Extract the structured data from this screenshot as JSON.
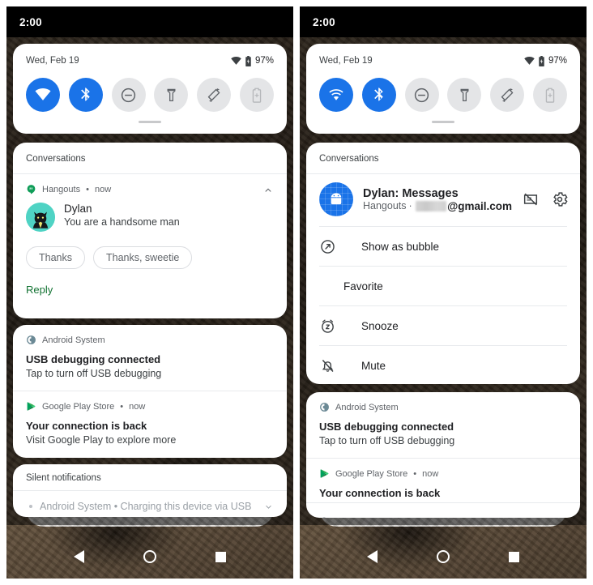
{
  "status_bar": {
    "clock": "2:00"
  },
  "quick_settings": {
    "date": "Wed, Feb 19",
    "battery_percent": "97%",
    "wifi_icon": "wifi-icon",
    "battery_icon": "battery-icon",
    "tiles": [
      {
        "name": "wifi-tile",
        "icon": "wifi-icon",
        "state": "on"
      },
      {
        "name": "bluetooth-tile",
        "icon": "bluetooth-icon",
        "state": "on"
      },
      {
        "name": "dnd-tile",
        "icon": "do-not-disturb-icon",
        "state": "off"
      },
      {
        "name": "flashlight-tile",
        "icon": "flashlight-icon",
        "state": "off"
      },
      {
        "name": "auto-rotate-tile",
        "icon": "auto-rotate-icon",
        "state": "off"
      },
      {
        "name": "battery-saver-tile",
        "icon": "battery-saver-icon",
        "state": "disabled"
      }
    ]
  },
  "left_panel": {
    "conversations_header": "Conversations",
    "conversation": {
      "app_name": "Hangouts",
      "separator": "•",
      "time": "now",
      "sender": "Dylan",
      "message": "You are a handsome man",
      "avatar": "cat-avatar",
      "collapse_icon": "chevron-up-icon",
      "smart_replies": [
        "Thanks",
        "Thanks, sweetie"
      ],
      "reply_label": "Reply",
      "reply_color": "#137333"
    },
    "notifications": [
      {
        "app_name": "Android System",
        "app_icon": "android-system-icon",
        "title": "USB debugging connected",
        "body": "Tap to turn off USB debugging"
      },
      {
        "app_name": "Google Play Store",
        "app_icon": "google-play-icon",
        "separator": "•",
        "time": "now",
        "title": "Your connection is back",
        "body": "Visit Google Play to explore more"
      }
    ],
    "silent": {
      "header": "Silent notifications",
      "row_text": "Android System • Charging this device via USB",
      "expand_icon": "chevron-down-icon"
    }
  },
  "right_panel": {
    "conversations_header": "Conversations",
    "conversation_header": {
      "title": "Dylan: Messages",
      "app_name": "Hangouts",
      "separator": "·",
      "account_masked": "",
      "account_domain": "@gmail.com",
      "avatar": "android-avatar",
      "block_icon": "block-message-icon",
      "settings_icon": "gear-icon"
    },
    "menu_items": [
      {
        "label": "Show as bubble",
        "icon": "bubble-icon"
      },
      {
        "label": "Favorite",
        "icon": "none"
      },
      {
        "label": "Snooze",
        "icon": "snooze-clock-icon"
      },
      {
        "label": "Mute",
        "icon": "bell-off-icon"
      }
    ],
    "notifications": [
      {
        "app_name": "Android System",
        "app_icon": "android-system-icon",
        "title": "USB debugging connected",
        "body": "Tap to turn off USB debugging"
      },
      {
        "app_name": "Google Play Store",
        "app_icon": "google-play-icon",
        "separator": "•",
        "time": "now",
        "title": "Your connection is back"
      }
    ]
  },
  "nav_bar": {
    "back": "back-button",
    "home": "home-button",
    "recents": "recents-button"
  },
  "colors": {
    "accent_blue": "#1a73e8",
    "reply_green": "#137333",
    "tile_off": "#e4e5e7"
  }
}
